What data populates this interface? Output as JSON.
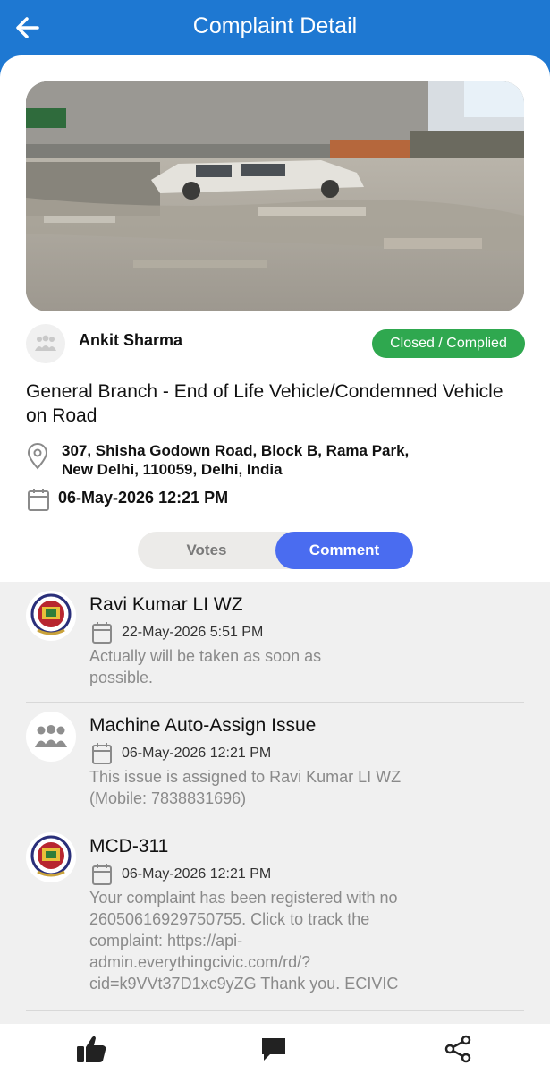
{
  "header": {
    "title": "Complaint Detail",
    "back_icon": "arrow-left-icon"
  },
  "complaint": {
    "author": "Ankit Sharma",
    "status": "Closed / Complied",
    "status_color": "#2FA84F",
    "category": "General Branch - End of Life Vehicle/Condemned Vehicle on Road",
    "address_line1": "307, Shisha Godown Road, Block B, Rama Park,",
    "address_line2": "New Delhi, 110059, Delhi, India",
    "datetime": "06-May-2026 12:21 PM"
  },
  "tabs": {
    "votes": "Votes",
    "comment": "Comment",
    "active": "comment"
  },
  "comments": [
    {
      "name": "Ravi Kumar LI WZ",
      "date": "22-May-2026 5:51 PM",
      "text_line1": "Actually will be taken as soon as",
      "text_line2": "possible.",
      "avatar": "mcd-emblem"
    },
    {
      "name": "Machine Auto-Assign Issue",
      "date": "06-May-2026 12:21 PM",
      "text_line1": "This issue is assigned to Ravi Kumar LI WZ",
      "text_line2": "(Mobile: 7838831696)",
      "avatar": "group-people-icon"
    },
    {
      "name": "MCD-311",
      "date": "06-May-2026 12:21 PM",
      "text_lines": [
        "Your complaint has been registered with no",
        "26050616929750755. Click to track the",
        "complaint: https://api-",
        "admin.everythingcivic.com/rd/?",
        "cid=k9VVt37D1xc9yZG Thank you. ECIVIC"
      ],
      "avatar": "mcd-emblem"
    }
  ],
  "bottom_nav": [
    "thumbs-up-icon",
    "comment-icon",
    "share-icon"
  ],
  "colors": {
    "brand": "#1E78D2",
    "accent": "#4A6CF0"
  }
}
